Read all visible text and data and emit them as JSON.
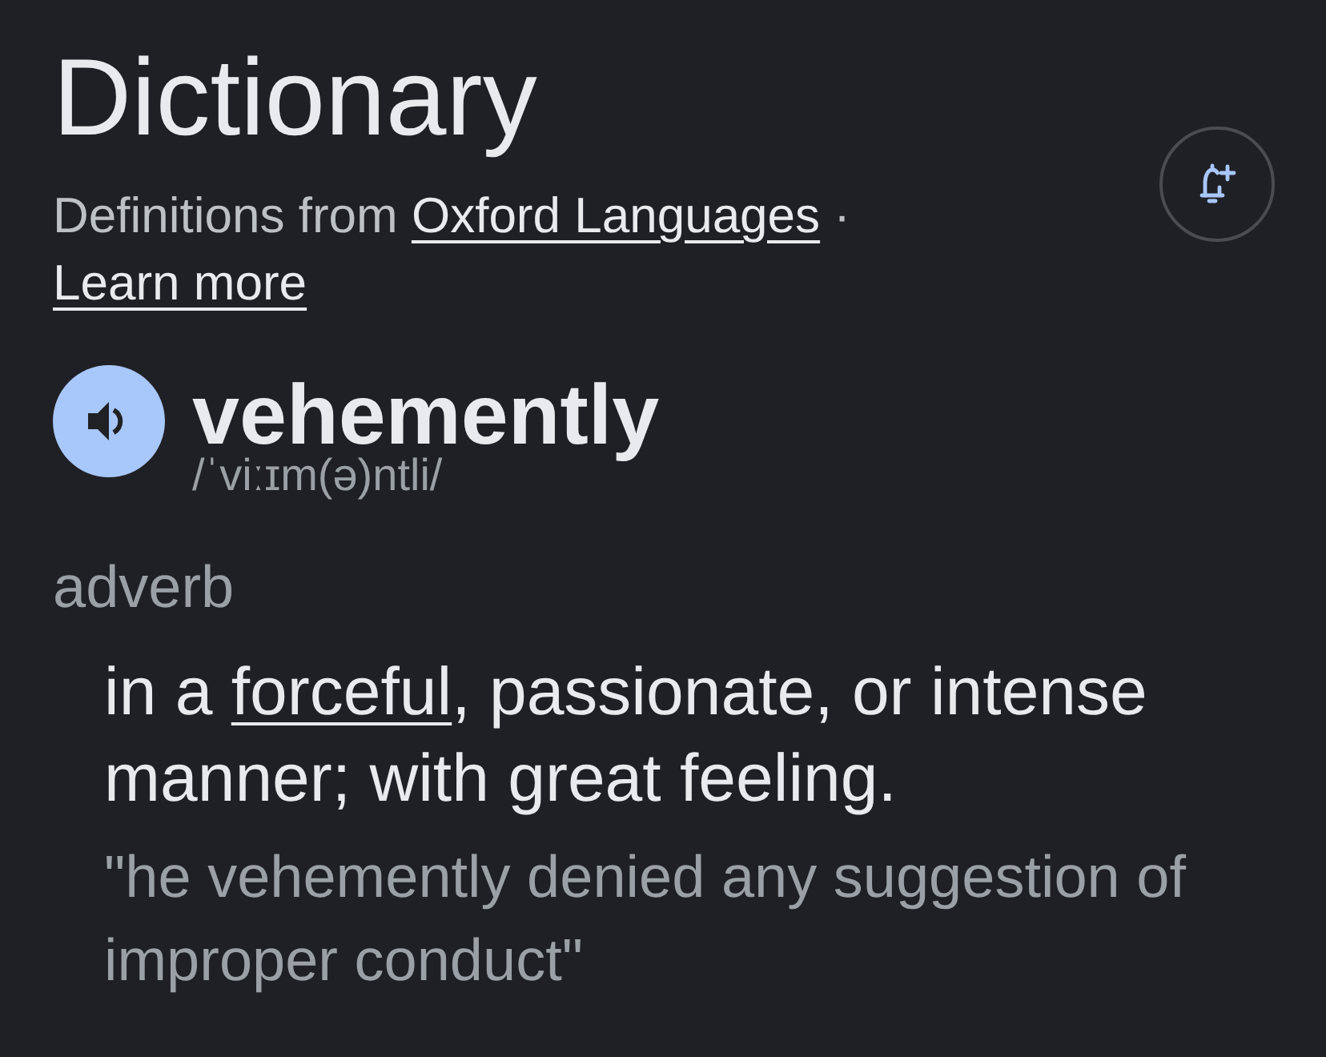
{
  "header": {
    "title": "Dictionary",
    "source": [
      {
        "kind": "text",
        "text": "Definitions from "
      },
      {
        "kind": "link",
        "text": "Oxford Languages"
      },
      {
        "kind": "text",
        "text": " · "
      },
      {
        "kind": "link",
        "text": "Learn more"
      }
    ]
  },
  "entry": {
    "word": "vehemently",
    "phonetic": "/ˈviːɪm(ə)ntli/"
  },
  "senses": [
    {
      "part_of_speech": "adverb",
      "definitions": [
        {
          "text": [
            {
              "kind": "text",
              "text": "in a "
            },
            {
              "kind": "link",
              "text": "forceful"
            },
            {
              "kind": "text",
              "text": ", passionate, or intense manner; with great feeling."
            }
          ],
          "example": "\"he vehemently denied any suggestion of improper conduct\""
        }
      ]
    }
  ]
}
